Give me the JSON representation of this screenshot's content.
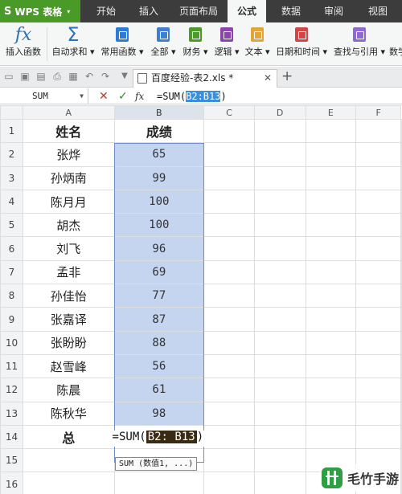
{
  "app": {
    "name": "WPS 表格",
    "logo": "S"
  },
  "menu_tabs": [
    "开始",
    "插入",
    "页面布局",
    "公式",
    "数据",
    "审阅",
    "视图"
  ],
  "active_tab": "公式",
  "ribbon": {
    "insert_function": "插入函数",
    "autosum": "自动求和",
    "common": "常用函数",
    "all": "全部",
    "finance": "财务",
    "logic": "逻辑",
    "text": "文本",
    "datetime": "日期和时间",
    "lookup": "查找与引用",
    "math": "数学"
  },
  "ribbon_colors": {
    "common": "#2e7bd6",
    "all": "#3f7fce",
    "finance": "#4c9a2a",
    "logic": "#8e44ad",
    "text": "#e3a43a",
    "datetime": "#d34545",
    "lookup": "#8e6ad0"
  },
  "document_tab": "百度经验-表2.xls *",
  "formula_bar": {
    "name_box": "SUM",
    "prefix": "=SUM(",
    "range": "B2:B13",
    "suffix": ")"
  },
  "columns": [
    "A",
    "B",
    "C",
    "D",
    "E",
    "F"
  ],
  "rows": [
    {
      "num": "1",
      "name": "姓名",
      "score": "成绩"
    },
    {
      "num": "2",
      "name": "张烨",
      "score": "65"
    },
    {
      "num": "3",
      "name": "孙炳南",
      "score": "99"
    },
    {
      "num": "4",
      "name": "陈月月",
      "score": "100"
    },
    {
      "num": "5",
      "name": "胡杰",
      "score": "100"
    },
    {
      "num": "6",
      "name": "刘飞",
      "score": "96"
    },
    {
      "num": "7",
      "name": "孟非",
      "score": "69"
    },
    {
      "num": "8",
      "name": "孙佳怡",
      "score": "77"
    },
    {
      "num": "9",
      "name": "张嘉译",
      "score": "87"
    },
    {
      "num": "10",
      "name": "张盼盼",
      "score": "88"
    },
    {
      "num": "11",
      "name": "赵雪峰",
      "score": "56"
    },
    {
      "num": "12",
      "name": "陈晨",
      "score": "61"
    },
    {
      "num": "13",
      "name": "陈秋华",
      "score": "98"
    }
  ],
  "total_row": {
    "num": "14",
    "label": "总",
    "prefix": "=SUM(",
    "range": "B2: B13",
    "suffix": ")"
  },
  "empty_rows": [
    "15",
    "16"
  ],
  "tooltip": "SUM (数值1, ...)",
  "watermark": "毛竹手游"
}
